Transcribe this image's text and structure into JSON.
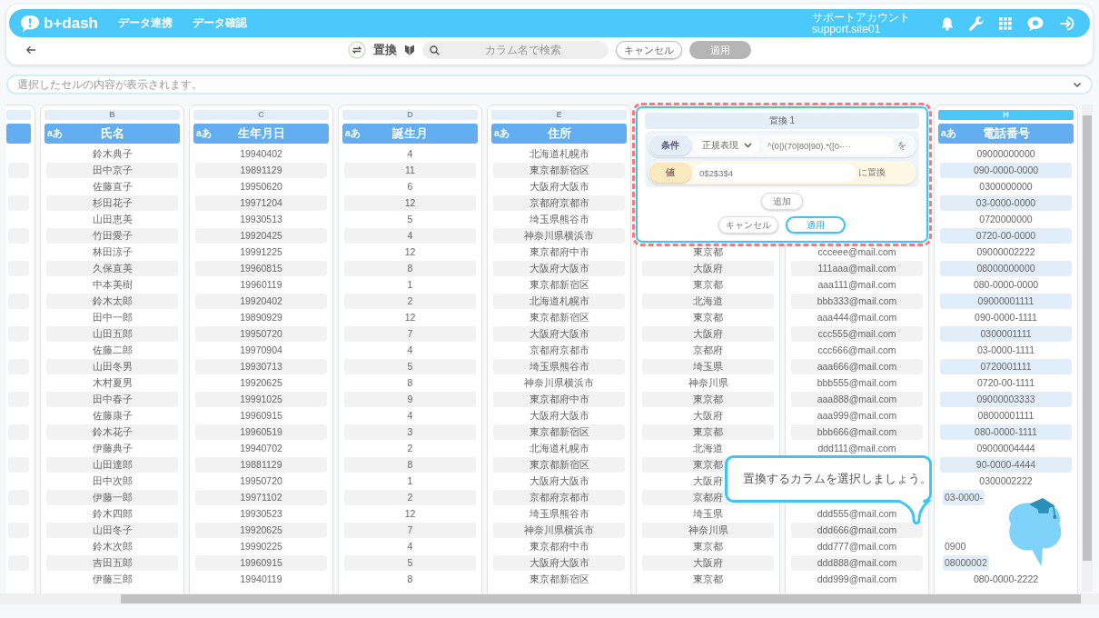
{
  "header": {
    "logo": "b+dash",
    "nav": [
      "データ連携",
      "データ確認"
    ],
    "account": {
      "name": "サポートアカウント",
      "id": "support.site01"
    }
  },
  "toolbar": {
    "title": "置換",
    "search": {
      "placeholder": "カラム名で検索"
    },
    "buttons": [
      {
        "label": "キャンセル",
        "disabled": false
      },
      {
        "label": "適用",
        "disabled": true
      }
    ]
  },
  "cell_viewer": {
    "placeholder": "選択したセルの内容が表示されます。"
  },
  "columns": [
    {
      "kind": "partial",
      "selected": false
    },
    {
      "kind": "data",
      "letter": "B",
      "type_label": "aあ",
      "title": "氏名",
      "selected": false,
      "cells": [
        "鈴木典子",
        "田中京子",
        "佐藤直子",
        "杉田花子",
        "山田恵美",
        "竹田愛子",
        "林田涼子",
        "久保直美",
        "中本美樹",
        "鈴木太郎",
        "田中一郎",
        "山田五郎",
        "佐藤二郎",
        "山田冬男",
        "木村夏男",
        "田中春子",
        "佐藤康子",
        "鈴木花子",
        "伊藤典子",
        "山田達郎",
        "田中次郎",
        "伊藤一郎",
        "鈴木四郎",
        "山田冬子",
        "鈴木次郎",
        "吉田五郎",
        "伊藤三郎"
      ]
    },
    {
      "kind": "data",
      "letter": "C",
      "type_label": "aあ",
      "title": "生年月日",
      "selected": false,
      "cells": [
        "19940402",
        "19891129",
        "19950620",
        "19971204",
        "19930513",
        "19920425",
        "19991225",
        "19960815",
        "19960119",
        "19920402",
        "19890929",
        "19950720",
        "19970904",
        "19930713",
        "19920625",
        "19991025",
        "19960915",
        "19960519",
        "19940702",
        "19881129",
        "19950720",
        "19971102",
        "19930523",
        "19920625",
        "19990225",
        "19960915",
        "19940119"
      ]
    },
    {
      "kind": "data",
      "letter": "D",
      "type_label": "aあ",
      "title": "誕生月",
      "selected": false,
      "cells": [
        "4",
        "11",
        "6",
        "12",
        "5",
        "4",
        "12",
        "8",
        "1",
        "2",
        "12",
        "7",
        "4",
        "5",
        "8",
        "9",
        "4",
        "3",
        "2",
        "8",
        "1",
        "2",
        "12",
        "7",
        "4",
        "5",
        "8"
      ]
    },
    {
      "kind": "data",
      "letter": "E",
      "type_label": "aあ",
      "title": "住所",
      "selected": false,
      "cells": [
        "北海道札幌市",
        "東京都新宿区",
        "大阪府大阪市",
        "京都府京都市",
        "埼玉県熊谷市",
        "神奈川県横浜市",
        "東京都府中市",
        "大阪府大阪市",
        "東京都新宿区",
        "北海道札幌市",
        "東京都新宿区",
        "大阪府大阪市",
        "京都府京都市",
        "埼玉県熊谷市",
        "神奈川県横浜市",
        "東京都府中市",
        "大阪府大阪市",
        "東京都新宿区",
        "北海道札幌市",
        "東京都新宿区",
        "大阪府大阪市",
        "京都府京都市",
        "埼玉県熊谷市",
        "神奈川県横浜市",
        "東京都府中市",
        "大阪府大阪市",
        "東京都新宿区"
      ]
    },
    {
      "kind": "data",
      "cells": [
        null,
        null,
        null,
        null,
        null,
        null,
        "東京都",
        "大阪府",
        "東京都",
        "北海道",
        "東京都",
        "大阪府",
        "京都府",
        "埼玉県",
        "神奈川県",
        "東京都",
        "大阪府",
        "東京都",
        "北海道",
        "東京都",
        "大阪府",
        "京都府",
        "埼玉県",
        "神奈川県",
        "東京都",
        "大阪府",
        "東京都"
      ]
    },
    {
      "kind": "data",
      "cells": [
        null,
        null,
        null,
        null,
        null,
        null,
        "ccceee@mail.com",
        "111aaa@mail.com",
        "aaa111@mail.com",
        "bbb333@mail.com",
        "aaa444@mail.com",
        "ccc555@mail.com",
        "ccc666@mail.com",
        "aaa666@mail.com",
        "bbb555@mail.com",
        "aaa888@mail.com",
        "aaa999@mail.com",
        "bbb666@mail.com",
        "ddd111@mail.com",
        null,
        null,
        null,
        "ddd555@mail.com",
        "ddd666@mail.com",
        "ddd777@mail.com",
        "ddd888@mail.com",
        "ddd999@mail.com"
      ]
    },
    {
      "kind": "data",
      "letter": "H",
      "type_label": "aあ",
      "title": "電話番号",
      "selected": true,
      "cells": [
        "09000000000",
        "090-0000-0000",
        "0300000000",
        "03-0000-0000",
        "0720000000",
        "0720-00-0000",
        "09000002222",
        "08000000000",
        "080-0000-0000",
        "09000001111",
        "090-0000-1111",
        "0300001111",
        "03-0000-1111",
        "0720001111",
        "0720-00-1111",
        "09000003333",
        "08000001111",
        "080-0000-1111",
        "09000004444",
        "90-0000-4444",
        "0300002222",
        {
          "text": "03-0000-",
          "cut": true
        },
        null,
        null,
        {
          "text": "0900",
          "cut": true
        },
        {
          "text": "08000002",
          "cut": true
        },
        "080-0000-2222"
      ]
    }
  ],
  "replace_dialog": {
    "title": "置換 1",
    "condition": {
      "label": "条件",
      "mode": "正規表現",
      "pattern": "^(0|)(70|80|90).*([0-···",
      "suffix": "を"
    },
    "value": {
      "label": "値",
      "text": "0$2$3$4",
      "suffix": "に置換"
    },
    "add_button": "追加",
    "buttons": [
      {
        "label": "キャンセル",
        "primary": false
      },
      {
        "label": "適用",
        "primary": true
      }
    ]
  },
  "hint": {
    "text": "置換するカラムを選択しましょう。"
  }
}
